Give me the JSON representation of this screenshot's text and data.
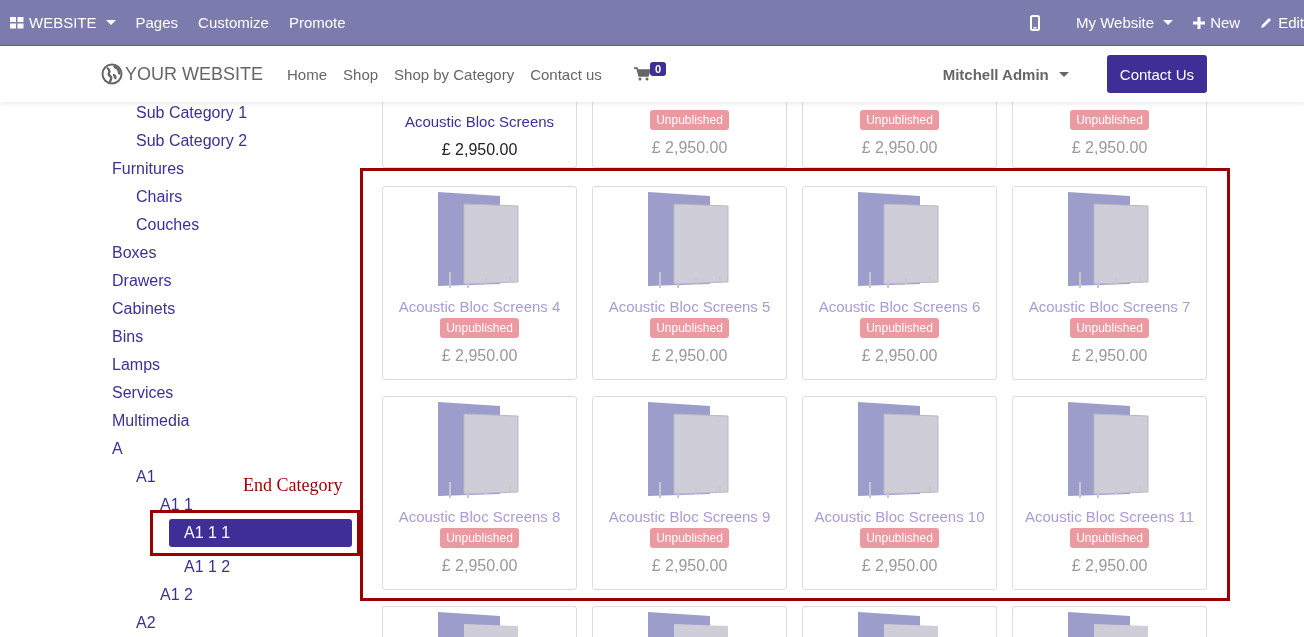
{
  "top_bar": {
    "app_menu": "WEBSITE",
    "left_items": [
      "Pages",
      "Customize",
      "Promote"
    ],
    "website_menu": "My Website",
    "new_button": "New",
    "edit_button": "Edit"
  },
  "nav": {
    "logo": "YOUR WEBSITE",
    "links": [
      "Home",
      "Shop",
      "Shop by Category",
      "Contact us"
    ],
    "cart_count": "0",
    "user": "Mitchell Admin",
    "contact_button": "Contact Us"
  },
  "sidebar": {
    "items": [
      {
        "children": [
          {
            "label": "Sub Category 1",
            "selected": false
          },
          {
            "label": "Sub Category 2",
            "selected": false
          }
        ]
      },
      {
        "label": "Furnitures",
        "selected": false,
        "children": [
          {
            "label": "Chairs",
            "selected": false
          },
          {
            "label": "Couches",
            "selected": false
          }
        ]
      },
      {
        "label": "Boxes",
        "selected": false
      },
      {
        "label": "Drawers",
        "selected": false
      },
      {
        "label": "Cabinets",
        "selected": false
      },
      {
        "label": "Bins",
        "selected": false
      },
      {
        "label": "Lamps",
        "selected": false
      },
      {
        "label": "Services",
        "selected": false
      },
      {
        "label": "Multimedia",
        "selected": false
      },
      {
        "label": "A",
        "selected": false,
        "children": [
          {
            "label": "A1",
            "selected": false,
            "children": [
              {
                "label": "A1 1",
                "selected": false,
                "children": [
                  {
                    "label": "A1 1 1",
                    "selected": true
                  },
                  {
                    "label": "A1 1 2",
                    "selected": false
                  }
                ]
              },
              {
                "label": "A1 2",
                "selected": false
              }
            ]
          },
          {
            "label": "A2",
            "selected": false
          }
        ]
      }
    ]
  },
  "annotation": {
    "label": "End Category"
  },
  "products_top_row": [
    {
      "name": "Acoustic Bloc Screens",
      "published": true,
      "price": "£ 2,950.00"
    },
    {
      "published": false,
      "badge": "Unpublished",
      "price": "£ 2,950.00"
    },
    {
      "published": false,
      "badge": "Unpublished",
      "price": "£ 2,950.00"
    },
    {
      "published": false,
      "badge": "Unpublished",
      "price": "£ 2,950.00"
    }
  ],
  "products": [
    {
      "name": "Acoustic Bloc Screens 4",
      "published": false,
      "badge": "Unpublished",
      "price": "£ 2,950.00"
    },
    {
      "name": "Acoustic Bloc Screens 5",
      "published": false,
      "badge": "Unpublished",
      "price": "£ 2,950.00"
    },
    {
      "name": "Acoustic Bloc Screens 6",
      "published": false,
      "badge": "Unpublished",
      "price": "£ 2,950.00"
    },
    {
      "name": "Acoustic Bloc Screens 7",
      "published": false,
      "badge": "Unpublished",
      "price": "£ 2,950.00"
    },
    {
      "name": "Acoustic Bloc Screens 8",
      "published": false,
      "badge": "Unpublished",
      "price": "£ 2,950.00"
    },
    {
      "name": "Acoustic Bloc Screens 9",
      "published": false,
      "badge": "Unpublished",
      "price": "£ 2,950.00"
    },
    {
      "name": "Acoustic Bloc Screens 10",
      "published": false,
      "badge": "Unpublished",
      "price": "£ 2,950.00"
    },
    {
      "name": "Acoustic Bloc Screens 11",
      "published": false,
      "badge": "Unpublished",
      "price": "£ 2,950.00"
    }
  ]
}
